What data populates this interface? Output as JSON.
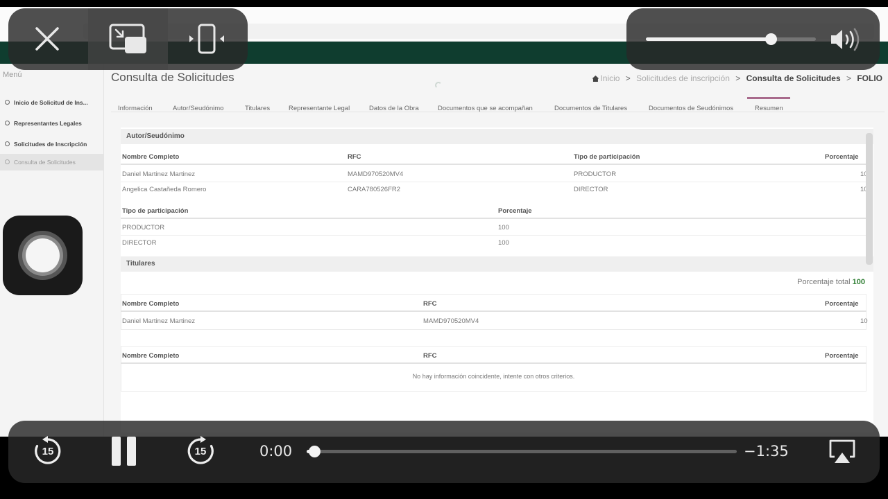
{
  "page": {
    "menu_title": "Menú",
    "sidebar": [
      {
        "label": "Inicio de Solicitud de Ins..."
      },
      {
        "label": "Representantes Legales"
      },
      {
        "label": "Solicitudes de Inscripción"
      },
      {
        "label": "Consulta de Solicitudes",
        "active": true
      }
    ],
    "title": "Consulta de Solicitudes",
    "breadcrumb": {
      "home": "Inicio",
      "step2": "Solicitudes de inscripción",
      "step3": "Consulta de Solicitudes",
      "step4": "FOLIO"
    },
    "tabs": [
      "Información",
      "Autor/Seudónimo",
      "Titulares",
      "Representante Legal",
      "Datos de la Obra",
      "Documentos que se acompañan",
      "Documentos de Titulares",
      "Documentos de Seudónimos",
      "Resumen"
    ],
    "active_tab": "Resumen",
    "autor_section": {
      "heading": "Autor/Seudónimo",
      "headers": [
        "Nombre Completo",
        "RFC",
        "Tipo de participación",
        "Porcentaje"
      ],
      "rows": [
        {
          "nombre": "Daniel Martinez Martinez",
          "rfc": "MAMD970520MV4",
          "tipo": "PRODUCTOR",
          "pct": "10"
        },
        {
          "nombre": "Angelica Castañeda Romero",
          "rfc": "CARA780526FR2",
          "tipo": "DIRECTOR",
          "pct": "10"
        }
      ],
      "sub_headers": [
        "Tipo de participación",
        "Porcentaje"
      ],
      "sub_rows": [
        {
          "tipo": "PRODUCTOR",
          "pct": "100"
        },
        {
          "tipo": "DIRECTOR",
          "pct": "100"
        }
      ]
    },
    "titulares_section": {
      "heading": "Titulares",
      "total_label": "Porcentaje total",
      "total_value": "100",
      "headers": [
        "Nombre Completo",
        "RFC",
        "Porcentaje"
      ],
      "rows": [
        {
          "nombre": "Daniel Martinez Martinez",
          "rfc": "MAMD970520MV4",
          "pct": "10"
        }
      ],
      "second_headers": [
        "Nombre Completo",
        "RFC",
        "Porcentaje"
      ],
      "empty_message": "No hay información coincidente, intente con otros criterios."
    }
  },
  "player": {
    "elapsed": "0:00",
    "remaining": "−1:35",
    "progress_fraction": 0.017,
    "skip_back_seconds": "15",
    "skip_forward_seconds": "15",
    "volume_fraction": 0.735,
    "icons": [
      "close-icon",
      "picture-in-picture-icon",
      "resize-icon",
      "speaker-icon",
      "skip-back-icon",
      "pause-icon",
      "skip-forward-icon",
      "airplay-icon"
    ]
  },
  "colors": {
    "gov_bar": "#0f3d2f",
    "overlay": "#282828",
    "active_tab_underline": "#a86a8c",
    "total_green": "#2e7d32"
  }
}
